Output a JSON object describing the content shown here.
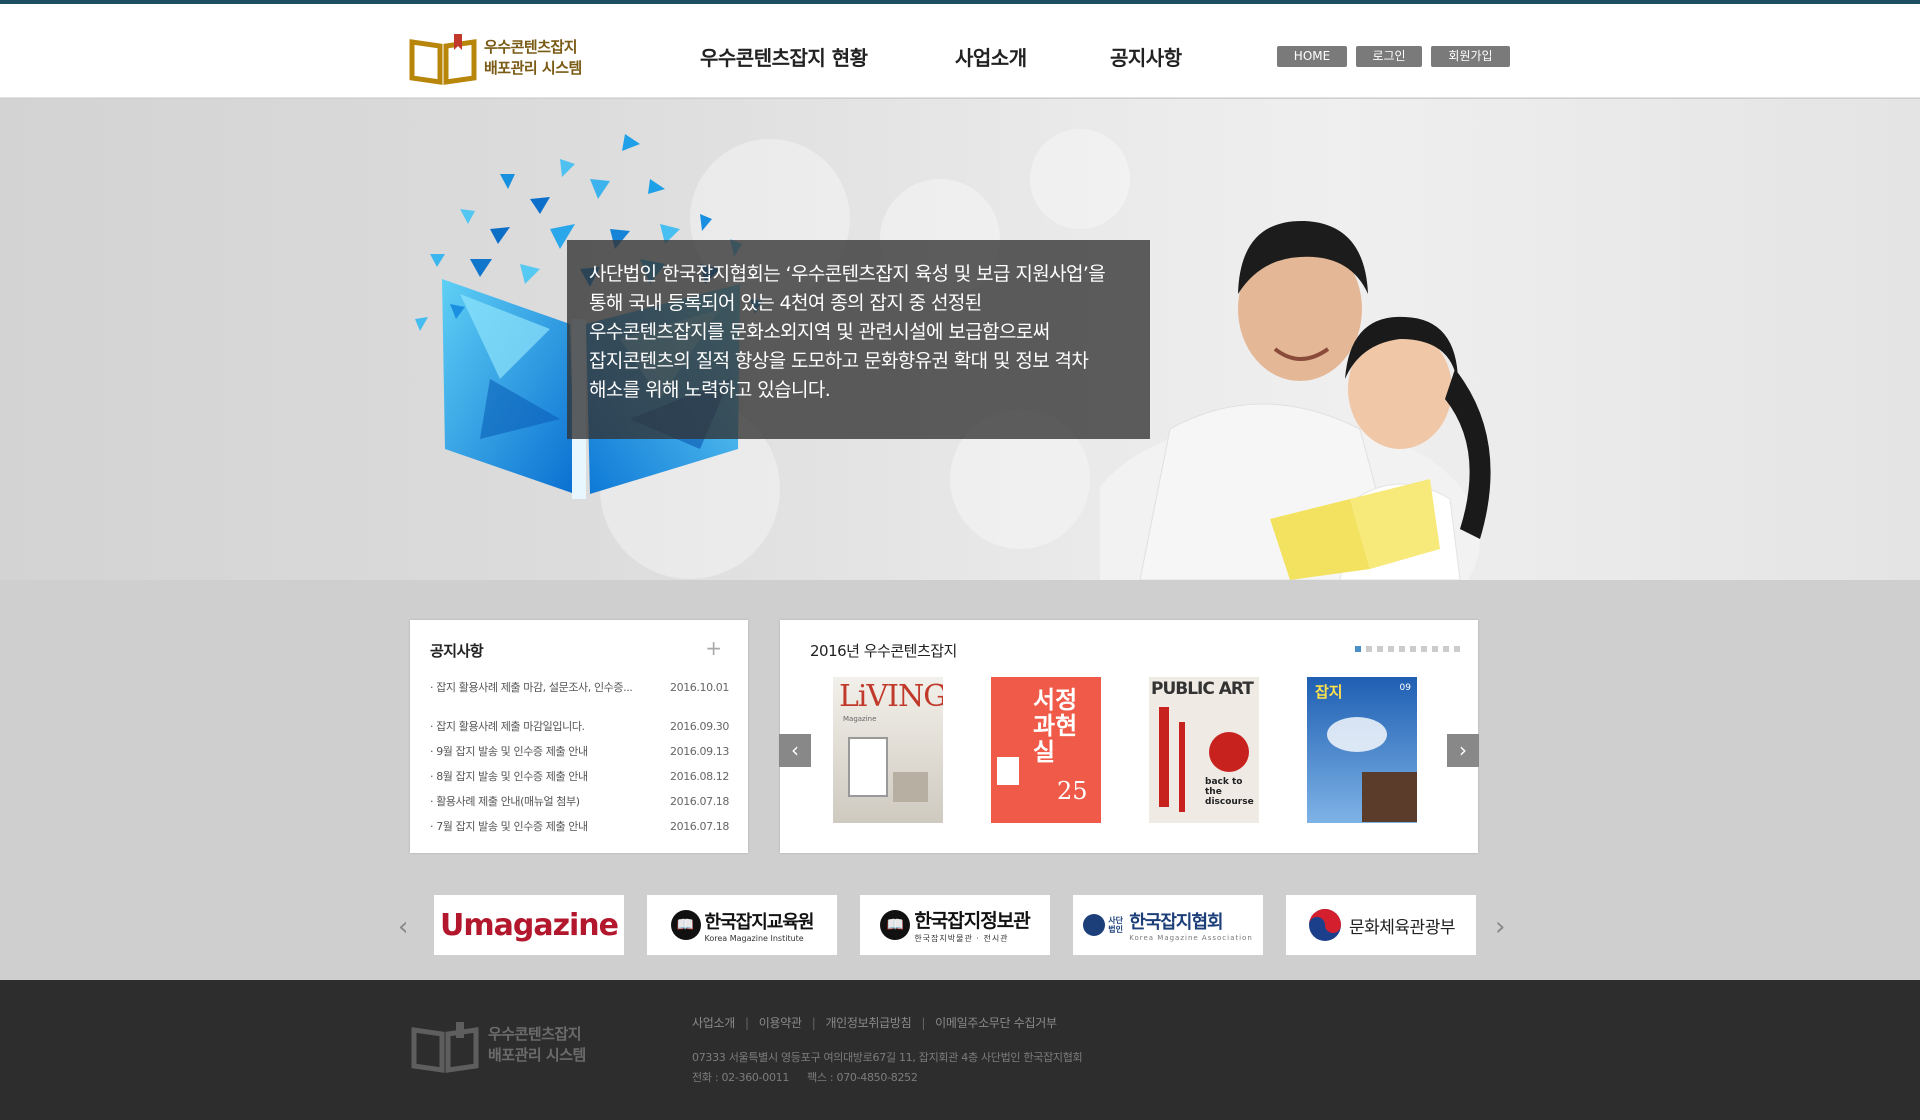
{
  "header": {
    "logo_line1": "우수콘텐츠잡지",
    "logo_line2": "배포관리 시스템",
    "nav": [
      "우수콘텐츠잡지 현황",
      "사업소개",
      "공지사항"
    ],
    "buttons": [
      "HOME",
      "로그인",
      "회원가입"
    ]
  },
  "hero": {
    "lines": [
      "사단법인 한국잡지협회는 ‘우수콘텐츠잡지 육성 및 보급 지원사업’을",
      "통해 국내 등록되어 있는 4천여 종의 잡지 중 선정된",
      "우수콘텐츠잡지를 문화소외지역 및 관련시설에 보급함으로써",
      "잡지콘텐츠의 질적 향상을 도모하고 문화향유권 확대 및 정보 격차",
      "해소를 위해 노력하고 있습니다."
    ]
  },
  "notice": {
    "title": "공지사항",
    "more": "+",
    "items": [
      {
        "text": "· 잡지 활용사례 제출 마감, 설문조사, 인수증...",
        "date": "2016.10.01"
      },
      {
        "text": "· 잡지 활용사례 제출 마감일입니다.",
        "date": "2016.09.30"
      },
      {
        "text": "· 9월 잡지 발송 및 인수증 제출 안내",
        "date": "2016.09.13"
      },
      {
        "text": "· 8월 잡지 발송 및 인수증 제출 안내",
        "date": "2016.08.12"
      },
      {
        "text": "· 활용사례 제출 안내(매뉴얼 첨부)",
        "date": "2016.07.18"
      },
      {
        "text": "· 7월 잡지 발송 및 인수증 제출 안내",
        "date": "2016.07.18"
      }
    ]
  },
  "magazines": {
    "title": "2016년 우수콘텐츠잡지",
    "dot_count": 10,
    "prev": "‹",
    "next": "›",
    "covers": [
      {
        "title": "LiVING",
        "subtitle": "Magazine"
      },
      {
        "title": "서정과현실",
        "number": "25"
      },
      {
        "title": "PUBLIC ART",
        "caption": "back to the discourse"
      },
      {
        "title": "잡지",
        "number": "09"
      }
    ]
  },
  "partners": {
    "prev": "‹",
    "next": "›",
    "items": [
      {
        "name": "Umagazine"
      },
      {
        "name": "한국잡지교육원",
        "sub": "Korea Magazine Institute"
      },
      {
        "name": "한국잡지정보관",
        "sub": "한국잡지박물관 · 전시관"
      },
      {
        "name": "한국잡지협회",
        "prefix": "사단법인",
        "sub": "Korea Magazine Association"
      },
      {
        "name": "문화체육관광부"
      }
    ]
  },
  "footer": {
    "logo_line1": "우수콘텐츠잡지",
    "logo_line2": "배포관리 시스템",
    "links": [
      "사업소개",
      "이용약관",
      "개인정보취급방침",
      "이메일주소무단 수집거부"
    ],
    "address": "07333 서울특별시 영등포구 여의대방로67길 11, 잡지회관 4층 사단법인 한국잡지협회",
    "phone": "전화 : 02-360-0011",
    "fax": "팩스 : 070-4850-8252"
  },
  "colors": {
    "brand_gold": "#b8860b",
    "brand_text": "#7a5a14",
    "top_line": "#1d4e62",
    "dot_active": "#4a8fc8",
    "footer_bg": "#2d2d2d"
  }
}
